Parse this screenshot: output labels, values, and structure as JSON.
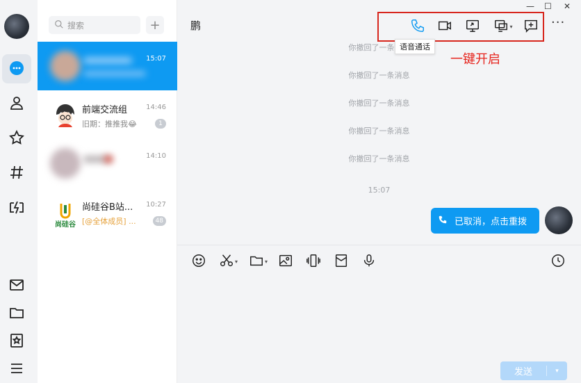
{
  "nav": {
    "items": [
      "chat",
      "contacts",
      "favorites",
      "channels",
      "games",
      "mail",
      "files",
      "collections",
      "menu"
    ]
  },
  "search": {
    "placeholder": "搜索"
  },
  "conversations": [
    {
      "name": "",
      "time": "15:07",
      "last_message": "",
      "badge": ""
    },
    {
      "name": "前端交流组",
      "time": "14:46",
      "last_message": "旧期：推推我😂",
      "badge": "1"
    },
    {
      "name": "",
      "time": "14:10",
      "last_message": "",
      "badge": ""
    },
    {
      "name": "尚硅谷B站...",
      "time": "10:27",
      "last_message": "[@全体成员] ...",
      "badge": "48"
    }
  ],
  "chat": {
    "title": "鹏",
    "tooltip": "语音通话",
    "annotation": "一键开启",
    "recall_messages": [
      "你撤回了一条消息",
      "你撤回了一条消息",
      "你撤回了一条消息",
      "你撤回了一条消息",
      "你撤回了一条消息"
    ],
    "timestamp": "15:07",
    "call_bubble": "已取消，点击重拨",
    "send_label": "发送"
  },
  "logo_text": "尚硅谷",
  "colors": {
    "accent": "#0e9af2",
    "annotation": "#e6231c",
    "send_disabled": "#b3d8fa"
  }
}
